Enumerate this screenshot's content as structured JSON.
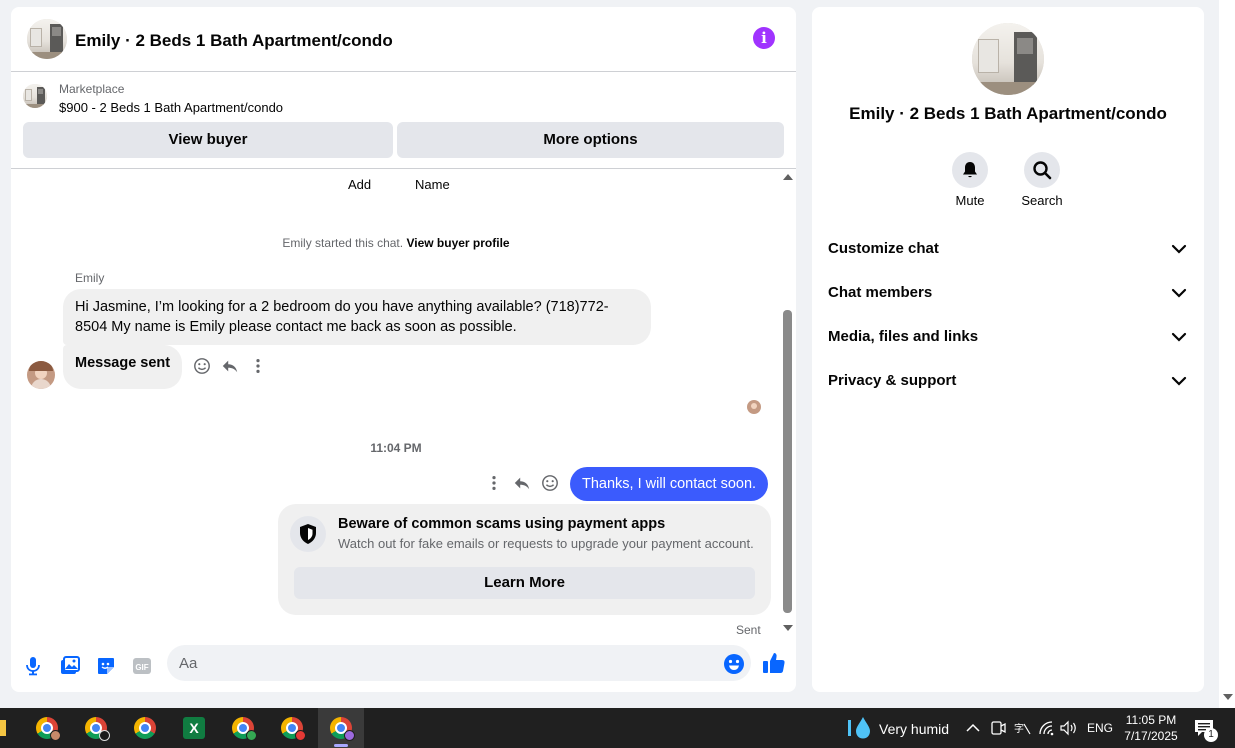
{
  "header": {
    "title": "Emily · 2 Beds 1 Bath Apartment/condo"
  },
  "marketplace": {
    "label": "Marketplace",
    "listing": "$900 - 2 Beds 1 Bath Apartment/condo",
    "view_buyer_label": "View buyer",
    "more_options_label": "More options"
  },
  "messages": {
    "col_add": "Add",
    "col_name": "Name",
    "system_text": "Emily started this chat.",
    "system_link": "View buyer profile",
    "sender_name": "Emily",
    "incoming_text": "Hi Jasmine, I’m looking for a 2 bedroom do you have anything available? (718)772-8504 My name is Emily please contact me back as soon as possible.",
    "incoming_status": "Message sent",
    "time": "11:04 PM",
    "outgoing_text": "Thanks, I will contact soon.",
    "scam_title": "Beware of common scams using payment apps",
    "scam_subtitle": "Watch out for fake emails or requests to upgrade your payment account.",
    "learn_more_label": "Learn More",
    "sent_label": "Sent"
  },
  "composer": {
    "placeholder": "Aa"
  },
  "info_panel": {
    "title": "Emily · 2 Beds 1 Bath Apartment/condo",
    "mute_label": "Mute",
    "search_label": "Search",
    "sections": [
      "Customize chat",
      "Chat members",
      "Media, files and links",
      "Privacy & support"
    ]
  },
  "taskbar": {
    "weather": "Very humid",
    "language": "ENG",
    "time": "11:05 PM",
    "date": "7/17/2025",
    "notification_count": "1"
  },
  "colors": {
    "accent_purple": "#a033ff",
    "outgoing_bubble": "#3b5bfd",
    "messenger_blue": "#0866ff",
    "bubble_grey": "#f0f0f0",
    "button_grey": "#e4e6eb",
    "secondary_text": "#65676b",
    "taskbar": "#202020"
  },
  "icons": {
    "info": "info-icon",
    "mute": "bell-icon",
    "search": "search-icon",
    "chevron": "chevron-down-icon",
    "microphone": "microphone-icon",
    "photo": "photo-icon",
    "sticker": "sticker-icon",
    "gif": "gif-icon",
    "emoji": "emoji-icon",
    "like": "thumbs-up-icon",
    "react": "smiley-icon",
    "reply": "reply-icon",
    "more": "more-vertical-icon",
    "shield": "shield-icon"
  }
}
